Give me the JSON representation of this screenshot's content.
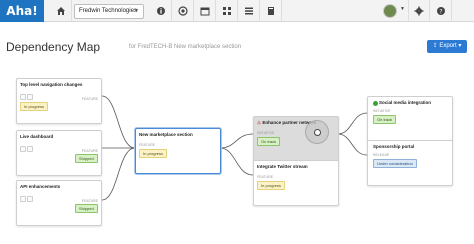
{
  "topbar": {
    "logo": "Aha!",
    "workspace": "Fredwin Technologies",
    "icons": [
      "home-icon",
      "workspace-caret-icon",
      "info-icon",
      "target-icon",
      "calendar-icon",
      "grid-icon",
      "list-icon",
      "book-icon"
    ],
    "right_icons": [
      "avatar",
      "gear-icon",
      "help-icon"
    ]
  },
  "header": {
    "title": "Dependency Map",
    "subtitle": "for FredTECH-B New marketplace section",
    "export_label": "Export"
  },
  "cards": [
    {
      "id": "c1",
      "name": "Top level navigation changes",
      "type": "FEATURE",
      "status": "In progress",
      "status_kind": "progress"
    },
    {
      "id": "c2",
      "name": "Live dashboard",
      "type": "FEATURE",
      "status": "Shipped",
      "status_kind": "shipped"
    },
    {
      "id": "c3",
      "name": "API enhancements",
      "type": "FEATURE",
      "status": "Shipped",
      "status_kind": "shipped"
    },
    {
      "id": "c4",
      "name": "New marketplace section",
      "type": "FEATURE",
      "status": "In progress",
      "status_kind": "progress"
    },
    {
      "id": "c5",
      "name": "Enhance partner network",
      "type": "INITIATIVE",
      "status": "On track",
      "status_kind": "ontrack",
      "warning": "⚠"
    },
    {
      "id": "c6",
      "name": "Integrate Twitter stream",
      "type": "FEATURE",
      "status": "In progress",
      "status_kind": "progress"
    },
    {
      "id": "c7",
      "name": "Social media integration",
      "type": "INITIATIVE",
      "status": "On track",
      "status_kind": "ontrack"
    },
    {
      "id": "c8",
      "name": "Sponsorship portal",
      "type": "RELEASE",
      "status": "Under consideration",
      "status_kind": "consider"
    }
  ],
  "colors": {
    "brand": "#1f74c2",
    "export": "#2b7bd4",
    "selected_border": "#4b8ad6"
  }
}
